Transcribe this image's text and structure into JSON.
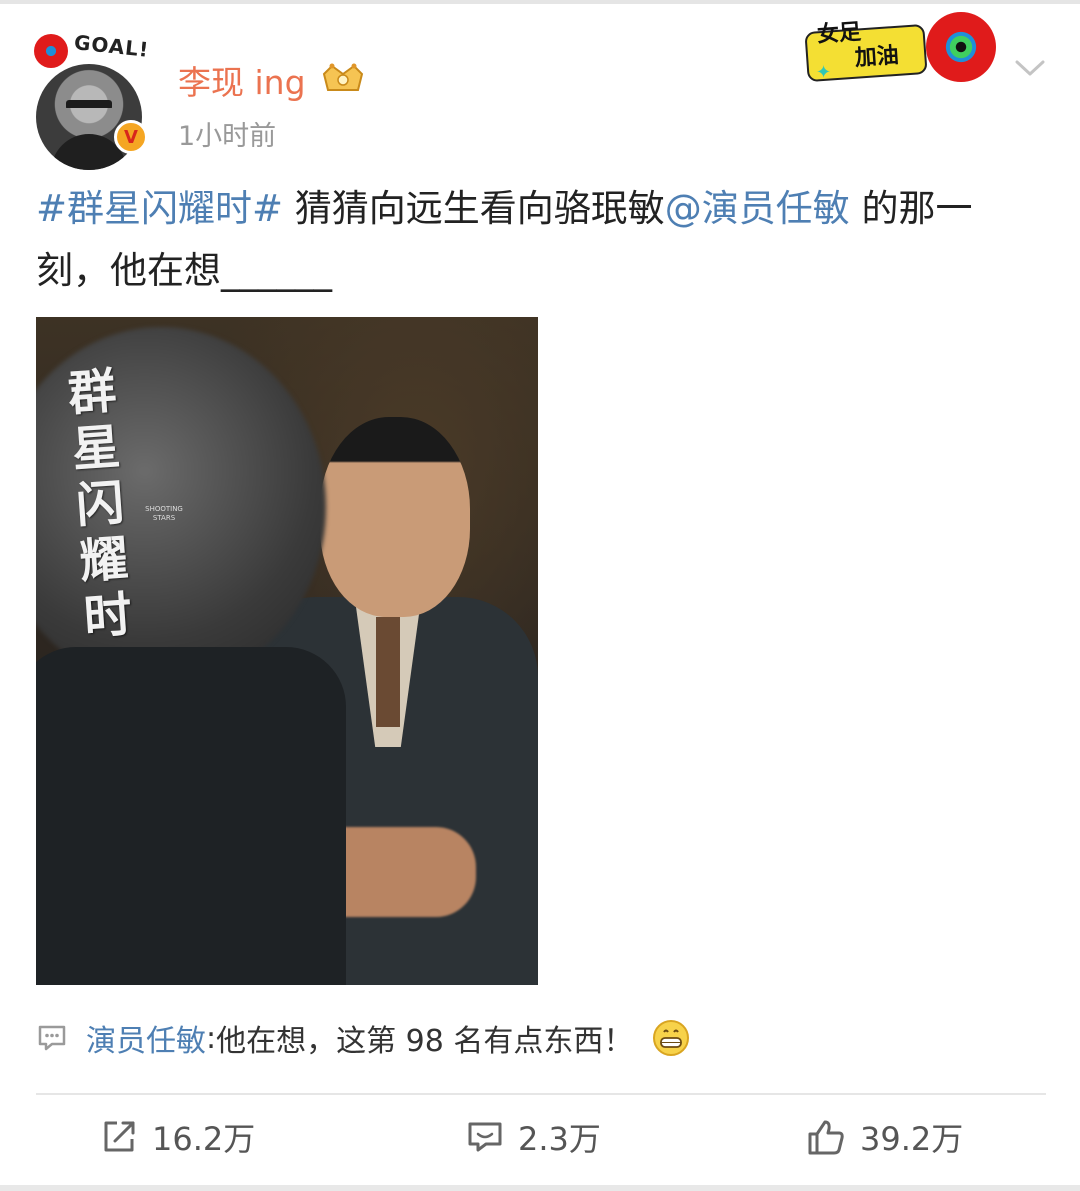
{
  "post": {
    "username": "李现 ing",
    "timestamp": "1小时前",
    "topic": "#群星闪耀时#",
    "text_part1": " 猜猜向远生看向骆珉敏",
    "mention": "@演员任敏",
    "text_part2": " 的那一刻，他在想______"
  },
  "header": {
    "goal_text": "GOAL!",
    "verified_mark": "V",
    "sticker_line1": "女足",
    "sticker_line2": "加油"
  },
  "image": {
    "poster_title": "群星闪耀时",
    "poster_subtitle": "SHOOTING STARS"
  },
  "comment": {
    "author": "演员任敏",
    "separator": ":",
    "text": " 他在想，这第 98 名有点东西！"
  },
  "actions": {
    "repost_count": "16.2万",
    "comment_count": "2.3万",
    "like_count": "39.2万"
  },
  "colors": {
    "username": "#eb7350",
    "link": "#4e7fb3",
    "timestamp": "#999999"
  },
  "icons": {
    "repost": "repost-icon",
    "comment": "comment-icon",
    "like": "thumbs-up-icon",
    "more": "chevron-down-icon"
  }
}
